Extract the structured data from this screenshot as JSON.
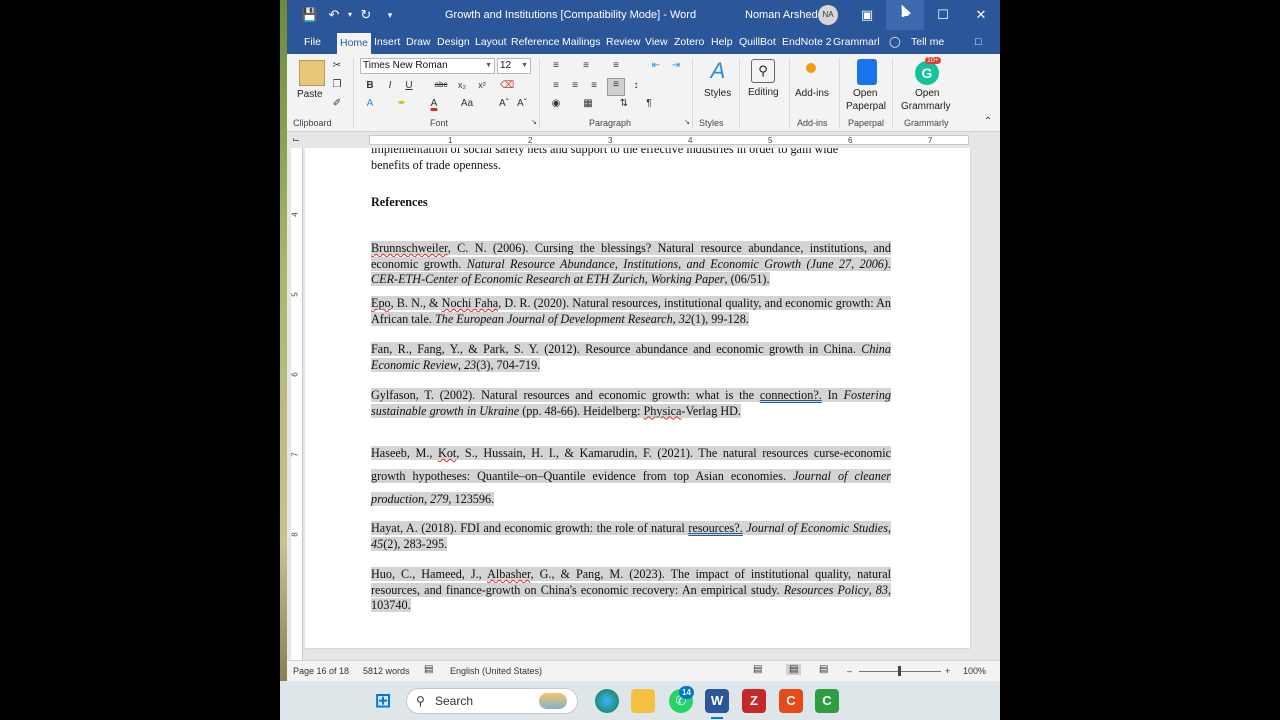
{
  "titlebar": {
    "doc_title": "Growth and Institutions [Compatibility Mode]  -  Word",
    "user_name": "Noman Arshed",
    "user_initials": "NA"
  },
  "tabs": [
    "File",
    "Home",
    "Insert",
    "Draw",
    "Design",
    "Layout",
    "Reference",
    "Mailings",
    "Review",
    "View",
    "Zotero",
    "Help",
    "QuillBot",
    "EndNote 2",
    "Grammarl",
    "Tell me"
  ],
  "ribbon": {
    "paste": "Paste",
    "font_name": "Times New Roman",
    "font_size": "12",
    "styles": "Styles",
    "editing": "Editing",
    "addins": "Add-ins",
    "open_paperpal_1": "Open",
    "open_paperpal_2": "Paperpal",
    "open_grammarly_1": "Open",
    "open_grammarly_2": "Grammarly",
    "grammarly_badge": "10+",
    "groups": {
      "clipboard": "Clipboard",
      "font": "Font",
      "paragraph": "Paragraph",
      "styles": "Styles",
      "addins": "Add-ins",
      "paperpal": "Paperpal",
      "grammarly": "Grammarly"
    }
  },
  "ruler_numbers": [
    "1",
    "2",
    "3",
    "4",
    "5",
    "6",
    "7"
  ],
  "vruler_numbers": [
    "4",
    "5",
    "6",
    "7",
    "8"
  ],
  "document": {
    "prev_line_1": "implementation of social safety nets and support to the effective industries in order to gain wide",
    "prev_line_2": "benefits of trade openness.",
    "heading": "References",
    "refs": [
      {
        "a": "Brunnschweiler",
        "b": ", C. N. (2006). Cursing the blessings? Natural resource abundance, institutions, and economic growth. ",
        "i": "Natural Resource Abundance, Institutions, and Economic Growth (June 27, 2006). CER-ETH-Center of Economic Research at ETH Zurich, Working Paper",
        "c": ", (06/51)."
      },
      {
        "a": "Epo",
        "b": ", B. N., & ",
        "a2": "Nochi Faha",
        "b2": ", D. R. (2020). Natural resources, institutional quality, and economic growth: An African tale. ",
        "i": "The European Journal of Development Research",
        "c": ", ",
        "i2": "32",
        "c2": "(1), 99-128."
      },
      {
        "b": "Fan, R., Fang, Y., & Park, S. Y. (2012). Resource abundance and economic growth in China. ",
        "i": "China Economic Review",
        "c": ", ",
        "i2": "23",
        "c2": "(3), 704-719."
      },
      {
        "b": "Gylfason, T. (2002). Natural resources and economic growth: what is the ",
        "u": "connection?.",
        "c": " In ",
        "i": "Fostering sustainable growth in Ukraine",
        "c2": " (pp. 48-66). Heidelberg: ",
        "a2": "Physica",
        "c3": "-Verlag HD."
      },
      {
        "b": "Haseeb, M., ",
        "a": "Kot",
        "b2": ", S., Hussain, H. I., & Kamarudin, F. (2021). The natural resources curse-economic growth hypotheses: Quantile–on–Quantile evidence from top Asian economies. ",
        "i": "Journal of cleaner production",
        "c": ", ",
        "i2": "279",
        "c2": ", 123596."
      },
      {
        "b": "Hayat, A. (2018). FDI and economic growth: the role of natural ",
        "u": "resources?.",
        "c": " ",
        "i": "Journal of Economic Studies",
        "c2": ", ",
        "i2": "45",
        "c3": "(2), 283-295."
      },
      {
        "b": "Huo, C., Hameed, J., ",
        "a": "Albasher",
        "b2": ", G., & Pang, M. (2023). The impact of institutional quality, natural resources, and finance-growth on China's economic recovery: An empirical study. ",
        "i": "Resources Policy",
        "c": ", ",
        "i2": "83",
        "c2": ", 103740."
      }
    ]
  },
  "statusbar": {
    "page": "Page 16 of 18",
    "words": "5812 words",
    "language": "English (United States)",
    "zoom": "100%"
  },
  "taskbar": {
    "search": "Search",
    "whatsapp_badge": "14"
  },
  "colors": {
    "word_blue": "#2b579a",
    "highlight": "#d4d4d4"
  }
}
